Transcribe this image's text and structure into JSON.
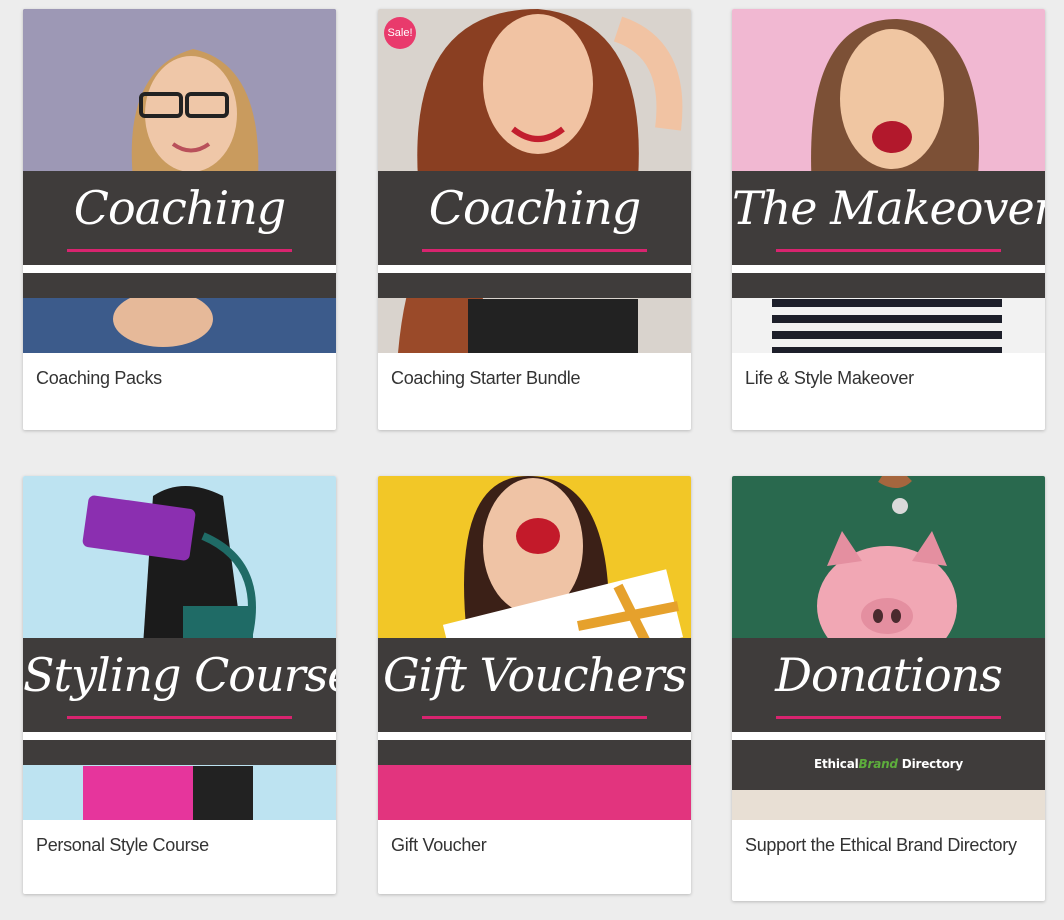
{
  "products": [
    {
      "banner_title": "Coaching",
      "name": "Coaching Packs",
      "photo_icon": "woman-with-glasses-photo"
    },
    {
      "banner_title": "Coaching",
      "name": "Coaching Starter Bundle",
      "badge": "Sale!",
      "photo_icon": "smiling-woman-photo"
    },
    {
      "banner_title": "The Makeover",
      "name": "Life & Style Makeover",
      "photo_icon": "laughing-woman-photo"
    },
    {
      "banner_title": "Styling Course",
      "name": "Personal Style Course",
      "photo_icon": "woman-with-purse-photo"
    },
    {
      "banner_title": "Gift Vouchers",
      "name": "Gift Voucher",
      "photo_icon": "woman-holding-gift-photo"
    },
    {
      "banner_title": "Donations",
      "name": "Support the Ethical Brand Directory",
      "photo_icon": "piggy-bank-photo",
      "strip_logo": {
        "part1": "Ethical",
        "part2": "Brand",
        "part3": " Directory"
      }
    }
  ],
  "colors": {
    "banner": "#3f3c3b",
    "accent": "#d8246f",
    "badge": "#e93a6c",
    "brand_green": "#5dad3c"
  }
}
